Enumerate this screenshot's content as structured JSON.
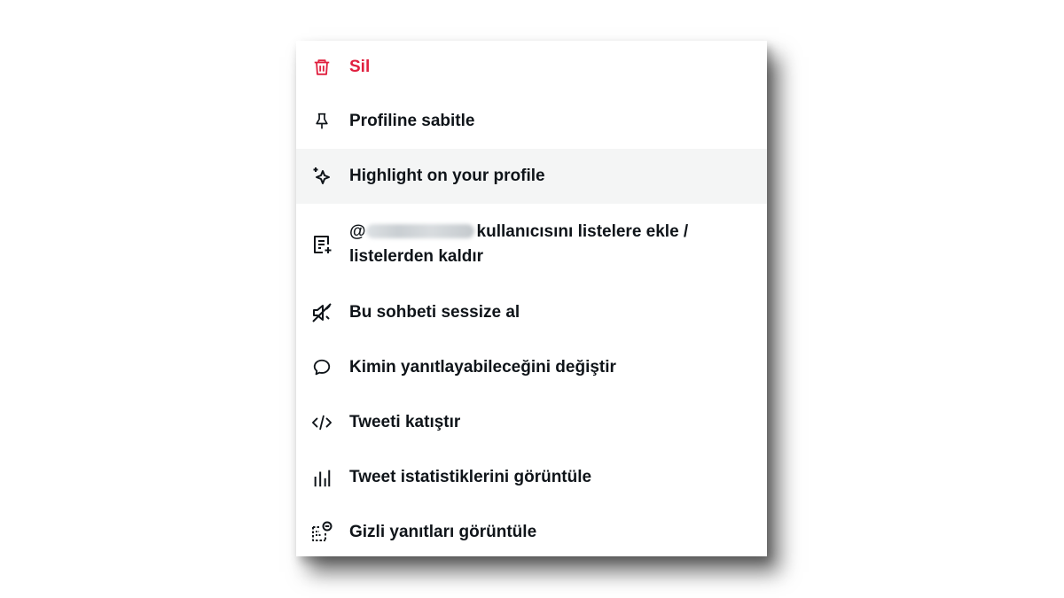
{
  "menu": {
    "items": [
      {
        "label": "Sil",
        "icon": "trash-icon",
        "danger": true
      },
      {
        "label": "Profiline sabitle",
        "icon": "pin-icon"
      },
      {
        "label": "Highlight on your profile",
        "icon": "sparkle-icon",
        "highlighted": true
      },
      {
        "label_prefix": "@",
        "label_suffix": "kullanıcısını listelere ekle /",
        "label_line2": "listelerden kaldır",
        "icon": "list-add-icon",
        "handle_blurred": true
      },
      {
        "label": "Bu sohbeti sessize al",
        "icon": "mute-icon"
      },
      {
        "label": "Kimin yanıtlayabileceğini değiştir",
        "icon": "speech-bubble-icon"
      },
      {
        "label": "Tweeti katıştır",
        "icon": "code-icon"
      },
      {
        "label": "Tweet istatistiklerini görüntüle",
        "icon": "bar-chart-icon"
      },
      {
        "label": "Gizli yanıtları görüntüle",
        "icon": "hidden-replies-icon"
      }
    ]
  },
  "colors": {
    "danger": "#e0203f",
    "text": "#0f1419",
    "highlight_bg": "#f4f5f5"
  }
}
